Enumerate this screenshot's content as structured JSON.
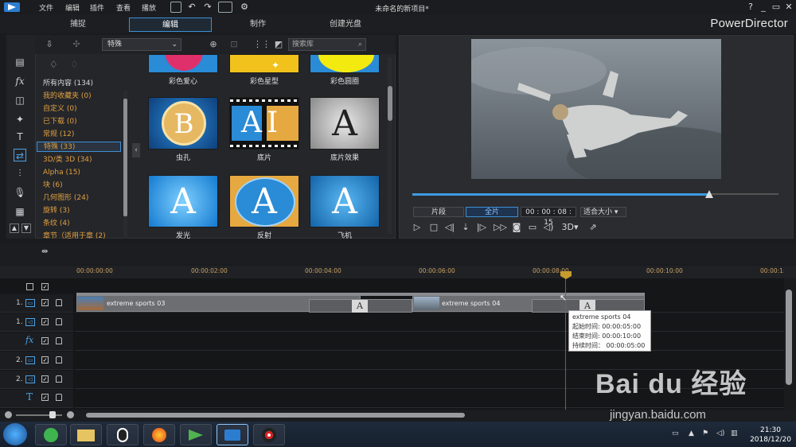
{
  "menu": [
    "文件",
    "编辑",
    "插件",
    "查看",
    "播放"
  ],
  "window_title": "未命名的新项目*",
  "window_controls": [
    "?",
    "_",
    "▭",
    "✕"
  ],
  "modes": [
    "捕捉",
    "编辑",
    "制作",
    "创建光盘"
  ],
  "brand": "PowerDirector",
  "library": {
    "category_select": "特殊",
    "search_placeholder": "搜索库",
    "categories": [
      "所有内容 (134)",
      "我的收藏夹 (0)",
      "自定义 (0)",
      "已下载 (0)",
      "常规 (12)",
      "特殊 (33)",
      "3D/类 3D (34)",
      "Alpha (15)",
      "块 (6)",
      "几何图形 (24)",
      "旋转 (3)",
      "条纹 (4)",
      "章节（适用于章 (2)"
    ],
    "tiles": [
      "彩色爱心",
      "彩色星型",
      "彩色圆圈",
      "虫孔",
      "底片",
      "底片效果",
      "发光",
      "反射",
      "飞机"
    ]
  },
  "preview": {
    "segment_label": "片段",
    "full_label": "全片",
    "timecode": "00 : 00 : 08 : 15",
    "fit_label": "适合大小",
    "view_3d": "3D",
    "progress": 0.81
  },
  "timeline": {
    "ruler": [
      "00:00:00:00",
      "00:00:02:00",
      "00:00:04:00",
      "00:00:06:00",
      "00:00:08:00",
      "00:00:10:00",
      "00:00:1:"
    ],
    "tracks": [
      "1.",
      "1.",
      "",
      "2.",
      "2.",
      ""
    ],
    "clips": [
      "extreme sports 03",
      "extreme sports 04"
    ],
    "tooltip": {
      "title": "extreme sports 04",
      "start": "起始时间: 00:00:05:00",
      "end": "结束时间: 00:00:10:00",
      "duration": "持续时间： 00:00:05:00"
    }
  },
  "taskbar": {
    "time": "21:30",
    "date": "2018/12/20"
  },
  "watermark": {
    "text": "Bai du 经验",
    "url": "jingyan.baidu.com"
  }
}
